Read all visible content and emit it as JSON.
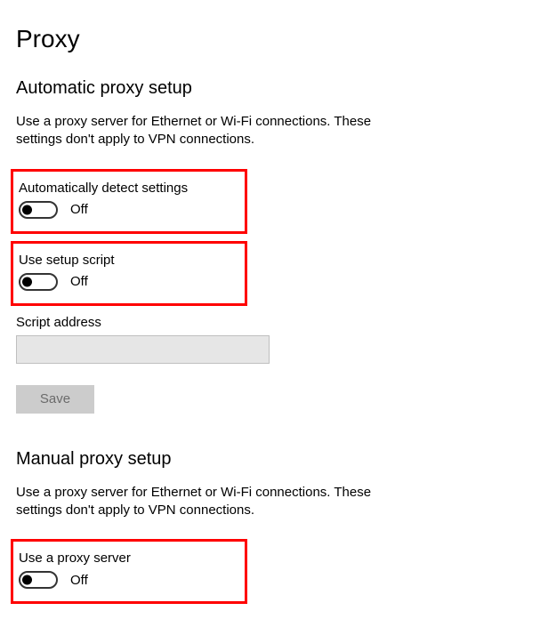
{
  "page_title": "Proxy",
  "sections": {
    "auto": {
      "title": "Automatic proxy setup",
      "desc": "Use a proxy server for Ethernet or Wi-Fi connections. These settings don't apply to VPN connections.",
      "detect": {
        "label": "Automatically detect settings",
        "state": "Off"
      },
      "script": {
        "label": "Use setup script",
        "state": "Off"
      },
      "script_address_label": "Script address",
      "script_address_value": "",
      "save_label": "Save"
    },
    "manual": {
      "title": "Manual proxy setup",
      "desc": "Use a proxy server for Ethernet or Wi-Fi connections. These settings don't apply to VPN connections.",
      "use_proxy": {
        "label": "Use a proxy server",
        "state": "Off"
      }
    }
  }
}
